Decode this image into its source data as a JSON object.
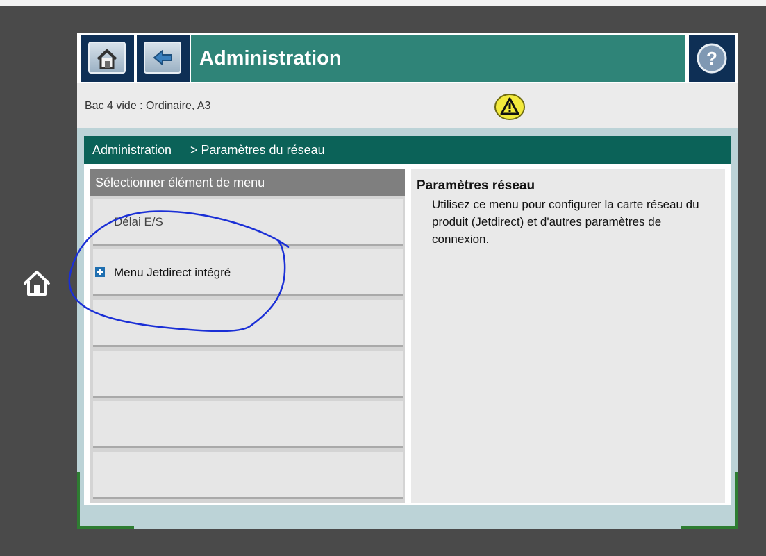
{
  "titlebar": {
    "title": "Administration",
    "home_icon": "home-icon",
    "back_icon": "back-arrow-icon",
    "help_icon": "help-icon"
  },
  "status": {
    "message": "Bac 4 vide : Ordinaire, A3",
    "warning_icon": "warning-icon"
  },
  "breadcrumb": {
    "parent": "Administration",
    "current": "> Paramètres du réseau"
  },
  "menu": {
    "header": "Sélectionner élément de menu",
    "items": [
      {
        "label": "Délai E/S",
        "expandable": false
      },
      {
        "label": "Menu Jetdirect intégré",
        "expandable": true
      }
    ]
  },
  "description": {
    "title": "Paramètres réseau",
    "body": "Utilisez ce menu pour configurer la carte réseau du produit (Jetdirect) et d'autres paramètres de connexion."
  },
  "colors": {
    "title_bar": "#2f8478",
    "breadcrumb_bar": "#0b6258",
    "nav_button": "#0e2f55",
    "annotation": "#1a2fd6"
  }
}
